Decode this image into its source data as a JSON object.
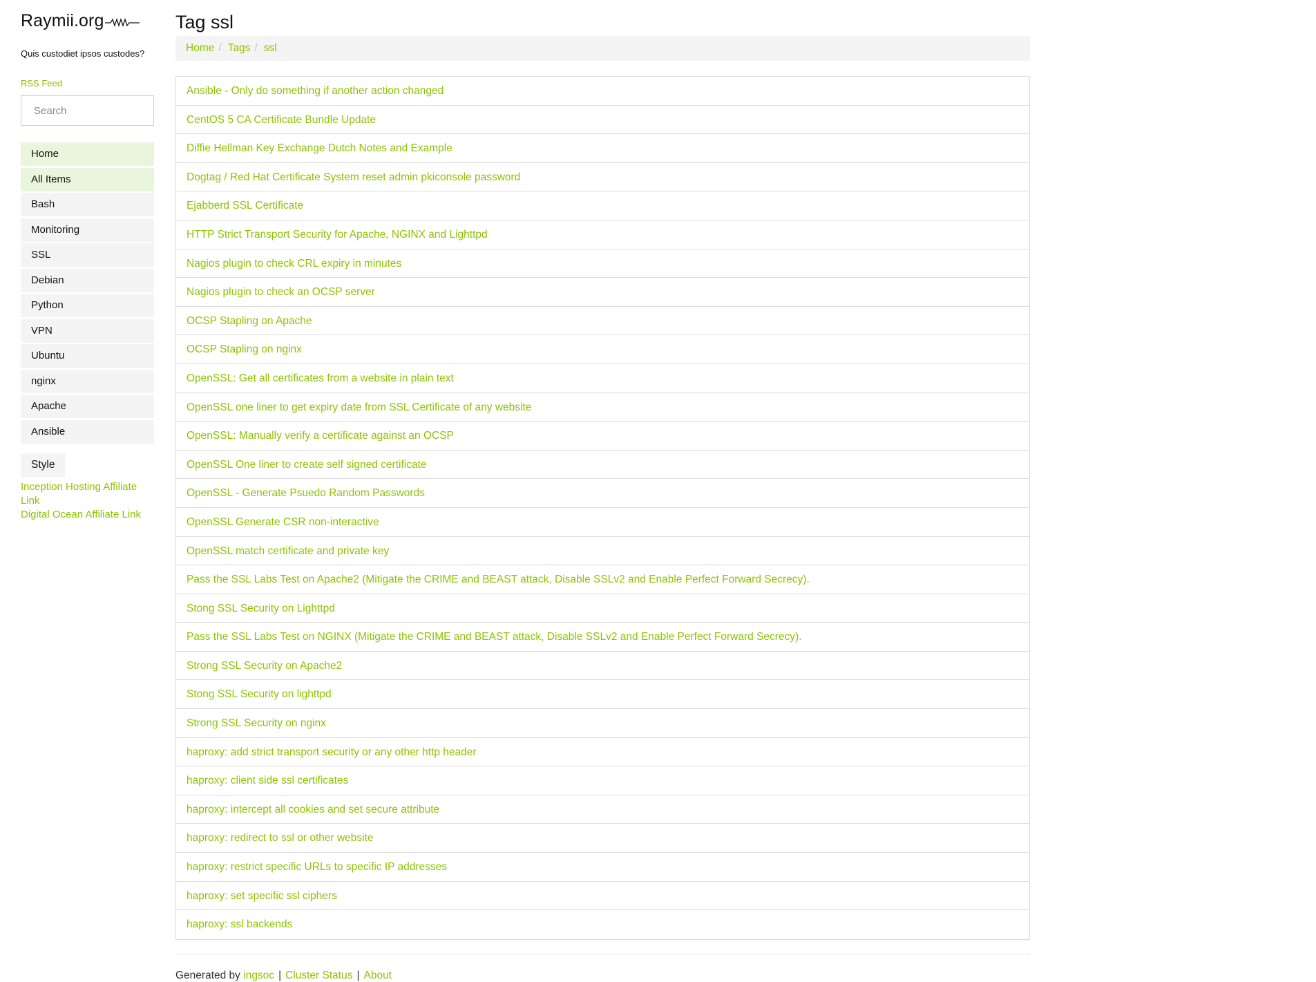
{
  "site": {
    "name": "Raymii.org",
    "tagline": "Quis custodiet ipsos custodes?",
    "rss": "RSS Feed",
    "accent": "#8dc400"
  },
  "search": {
    "placeholder": "Search",
    "value": ""
  },
  "nav": {
    "items": [
      "Home",
      "All Items",
      "Bash",
      "Monitoring",
      "SSL",
      "Debian",
      "Python",
      "VPN",
      "Ubuntu",
      "nginx",
      "Apache",
      "Ansible"
    ],
    "style": "Style"
  },
  "affiliates": {
    "inception": "Inception Hosting Affiliate Link",
    "digital_ocean": "Digital Ocean Affiliate Link"
  },
  "main": {
    "title": "Tag ssl",
    "breadcrumb": [
      "Home",
      "Tags",
      "ssl"
    ],
    "breadcrumb_separator": "/",
    "articles": [
      "Ansible - Only do something if another action changed",
      "CentOS 5 CA Certificate Bundle Update",
      "Diffie Hellman Key Exchange Dutch Notes and Example",
      "Dogtag / Red Hat Certificate System reset admin pkiconsole password",
      "Ejabberd SSL Certificate",
      "HTTP Strict Transport Security for Apache, NGINX and Lighttpd",
      "Nagios plugin to check CRL expiry in minutes",
      "Nagios plugin to check an OCSP server",
      "OCSP Stapling on Apache",
      "OCSP Stapling on nginx",
      "OpenSSL: Get all certificates from a website in plain text",
      "OpenSSL one liner to get expiry date from SSL Certificate of any website",
      "OpenSSL: Manually verify a certificate against an OCSP",
      "OpenSSL One liner to create self signed certificate",
      "OpenSSL - Generate Psuedo Random Passwords",
      "OpenSSL Generate CSR non-interactive",
      "OpenSSL match certificate and private key",
      "Pass the SSL Labs Test on Apache2 (Mitigate the CRIME and BEAST attack, Disable SSLv2 and Enable Perfect Forward Secrecy).",
      "Stong SSL Security on Lighttpd",
      "Pass the SSL Labs Test on NGINX (Mitigate the CRIME and BEAST attack, Disable SSLv2 and Enable Perfect Forward Secrecy).",
      "Strong SSL Security on Apache2",
      "Stong SSL Security on lighttpd",
      "Strong SSL Security on nginx",
      "haproxy: add strict transport security or any other http header",
      "haproxy: client side ssl certificates",
      "haproxy: intercept all cookies and set secure attribute",
      "haproxy: redirect to ssl or other website",
      "haproxy: restrict specific URLs to specific IP addresses",
      "haproxy: set specific ssl ciphers",
      "haproxy: ssl backends"
    ]
  },
  "footer": {
    "generated_by": "Generated by",
    "ingsoc": "ingsoc",
    "cluster_status": "Cluster Status",
    "about": "About",
    "separator": "|"
  }
}
